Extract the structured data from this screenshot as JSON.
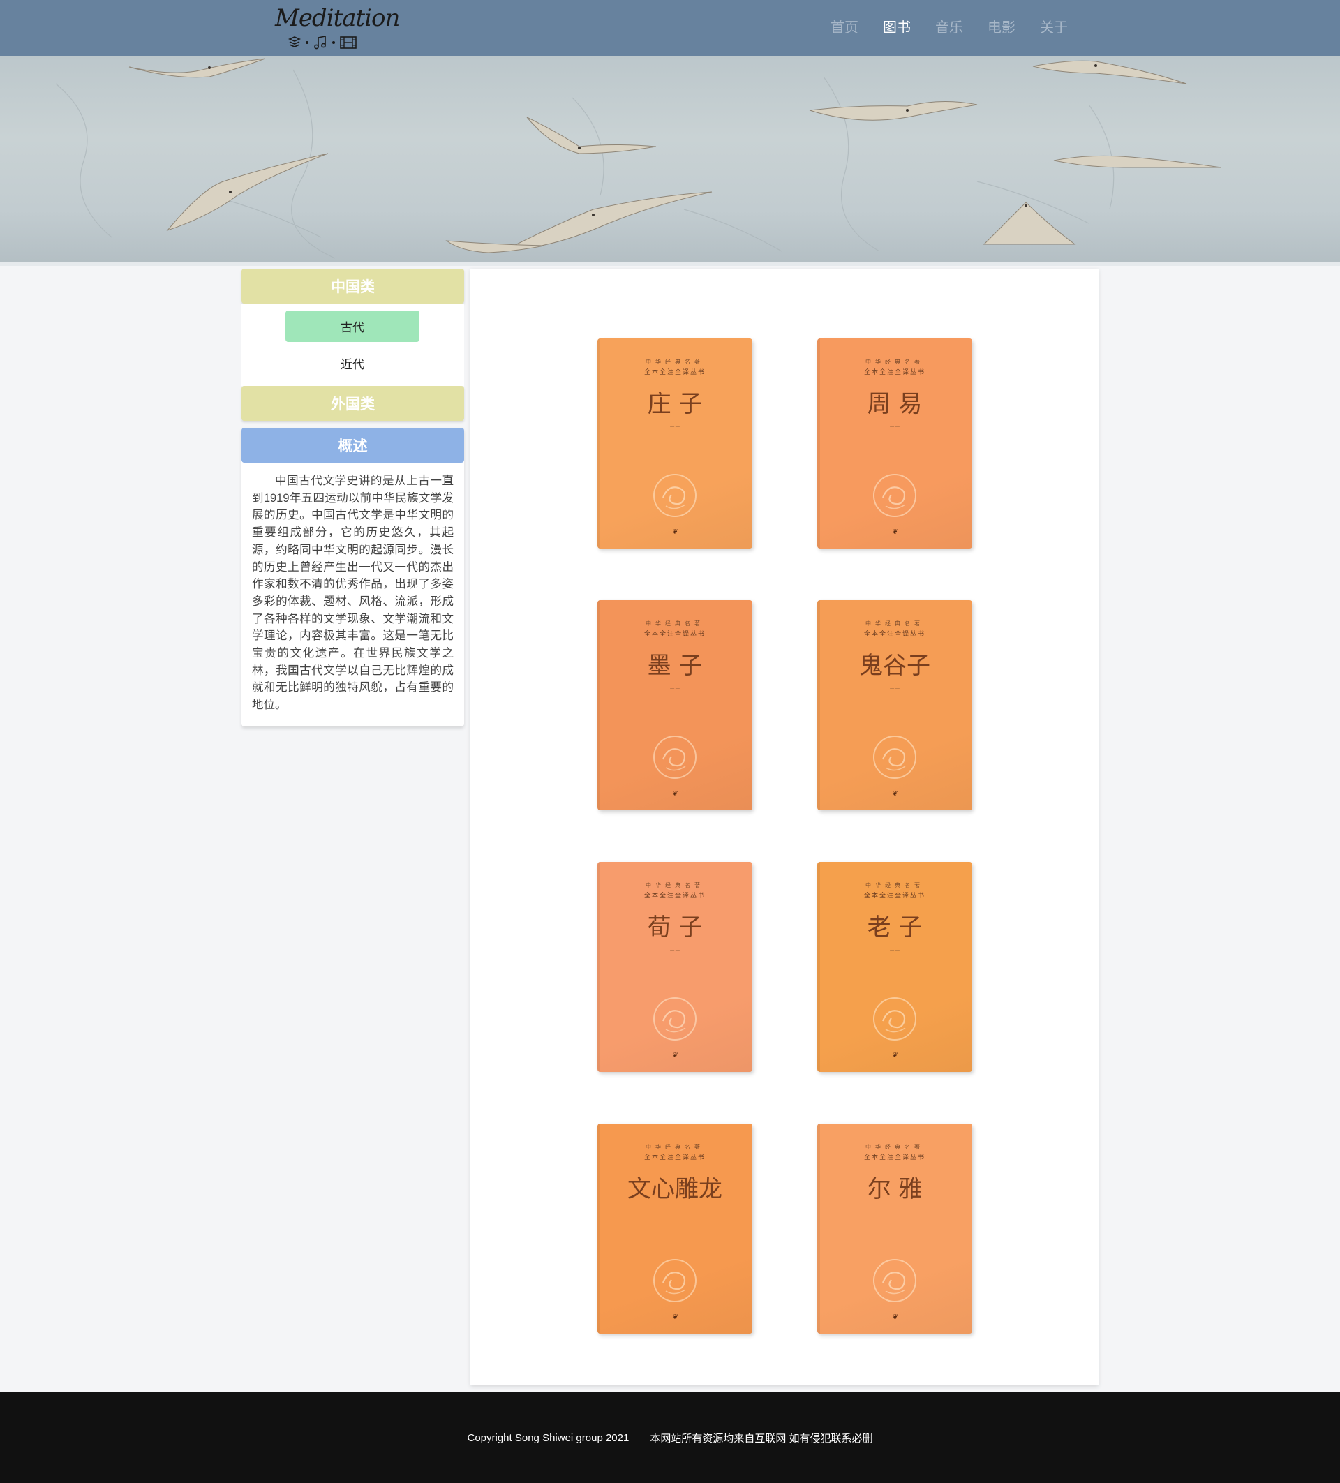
{
  "header": {
    "logo_text": "Meditation",
    "nav": [
      "首页",
      "图书",
      "音乐",
      "电影",
      "关于"
    ],
    "active_nav": "图书"
  },
  "sidebar": {
    "category_china": "中国类",
    "sub_items": [
      "古代",
      "近代"
    ],
    "active_sub": "古代",
    "category_foreign": "外国类",
    "overview_title": "概述",
    "overview_text": "中国古代文学史讲的是从上古一直到1919年五四运动以前中华民族文学发展的历史。中国古代文学是中华文明的重要组成部分，它的历史悠久，其起源，约略同中华文明的起源同步。漫长的历史上曾经产生出一代又一代的杰出作家和数不清的优秀作品，出现了多姿多彩的体裁、题材、风格、流派，形成了各种各样的文学现象、文学潮流和文学理论，内容极其丰富。这是一笔无比宝贵的文化遗产。在世界民族文学之林，我国古代文学以自己无比辉煌的成就和无比鲜明的独特风貌，占有重要的地位。"
  },
  "books": [
    {
      "title": "庄 子",
      "series_top": "中华经典名著",
      "series": "全本全注全译丛书",
      "color": "#f7a25a"
    },
    {
      "title": "周 易",
      "series_top": "中华经典名著",
      "series": "全本全注全译丛书",
      "color": "#f79a5e"
    },
    {
      "title": "墨 子",
      "series_top": "中华经典名著",
      "series": "全本全注全译丛书",
      "color": "#f39459"
    },
    {
      "title": "鬼谷子",
      "series_top": "中华经典名著",
      "series": "全本全注全译丛书",
      "color": "#f59d55"
    },
    {
      "title": "荀 子",
      "series_top": "中华经典名著",
      "series": "全本全注全译丛书",
      "color": "#f79c6c"
    },
    {
      "title": "老 子",
      "series_top": "中华经典名著",
      "series": "全本全注全译丛书",
      "color": "#f5a04c"
    },
    {
      "title": "文心雕龙",
      "series_top": "中华经典名著",
      "series": "全本全注全译丛书",
      "color": "#f6994f"
    },
    {
      "title": "尔 雅",
      "series_top": "中华经典名著",
      "series": "全本全注全译丛书",
      "color": "#f8a063"
    }
  ],
  "footer": {
    "copyright": "Copyright Song Shiwei group 2021",
    "notice": "本网站所有资源均来自互联网 如有侵犯联系必删"
  }
}
